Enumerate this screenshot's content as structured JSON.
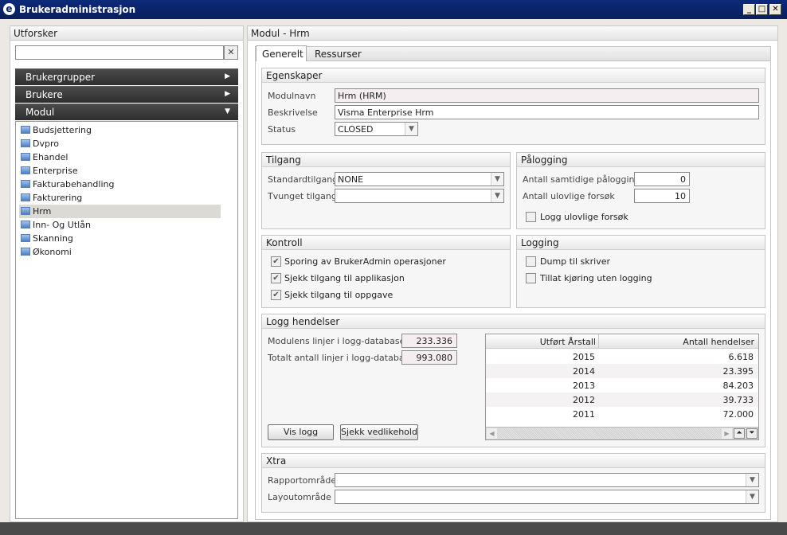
{
  "window": {
    "title": "Brukeradministrasjon",
    "logo": "e",
    "controls": [
      "minimize-icon",
      "maximize-icon",
      "close-icon"
    ]
  },
  "explorer": {
    "title": "Utforsker",
    "search_value": "",
    "clear_icon": "✕",
    "sections": [
      {
        "label": "Brukergrupper",
        "state": "collapsed"
      },
      {
        "label": "Brukere",
        "state": "collapsed"
      },
      {
        "label": "Modul",
        "state": "expanded"
      }
    ],
    "modules": [
      "Budsjettering",
      "Dvpro",
      "Ehandel",
      "Enterprise",
      "Fakturabehandling",
      "Fakturering",
      "Hrm",
      "Inn- Og Utlån",
      "Skanning",
      "Økonomi"
    ],
    "selected": "Hrm"
  },
  "main": {
    "title": "Modul - Hrm",
    "tabs": [
      {
        "label": "Generelt",
        "active": true
      },
      {
        "label": "Ressurser",
        "active": false
      }
    ],
    "egenskaper": {
      "title": "Egenskaper",
      "modulnavn_label": "Modulnavn",
      "modulnavn": "Hrm (HRM)",
      "beskrivelse_label": "Beskrivelse",
      "beskrivelse": "Visma Enterprise Hrm",
      "status_label": "Status",
      "status": "CLOSED"
    },
    "tilgang": {
      "title": "Tilgang",
      "standard_label": "Standardtilgang",
      "standard": "NONE",
      "tvunget_label": "Tvunget tilgang",
      "tvunget": ""
    },
    "palogging": {
      "title": "Pålogging",
      "samtidige_label": "Antall samtidige pålogginger",
      "samtidige": "0",
      "ulovlige_label": "Antall ulovlige forsøk",
      "ulovlige": "10",
      "logg_label": "Logg ulovlige forsøk",
      "logg_checked": false
    },
    "kontroll": {
      "title": "Kontroll",
      "items": [
        {
          "label": "Sporing av BrukerAdmin operasjoner",
          "checked": true
        },
        {
          "label": "Sjekk tilgang til applikasjon",
          "checked": true
        },
        {
          "label": "Sjekk tilgang til oppgave",
          "checked": true
        }
      ]
    },
    "logging": {
      "title": "Logging",
      "items": [
        {
          "label": "Dump til skriver",
          "checked": false
        },
        {
          "label": "Tillat kjøring uten logging",
          "checked": false
        }
      ]
    },
    "logg": {
      "title": "Logg hendelser",
      "modul_label": "Modulens linjer i logg-databasen",
      "modul": "233.336",
      "totalt_label": "Totalt antall linjer i logg-databasen",
      "totalt": "993.080",
      "vis_button": "Vis logg",
      "sjekk_button": "Sjekk vedlikehold",
      "columns": [
        "Utført Årstall",
        "Antall hendelser"
      ],
      "rows": [
        [
          "2015",
          "6.618"
        ],
        [
          "2014",
          "23.395"
        ],
        [
          "2013",
          "84.203"
        ],
        [
          "2012",
          "39.733"
        ],
        [
          "2011",
          "72.000"
        ]
      ]
    },
    "xtra": {
      "title": "Xtra",
      "rapport_label": "Rapportområde",
      "rapport": "",
      "layout_label": "Layoutområde",
      "layout": ""
    }
  }
}
